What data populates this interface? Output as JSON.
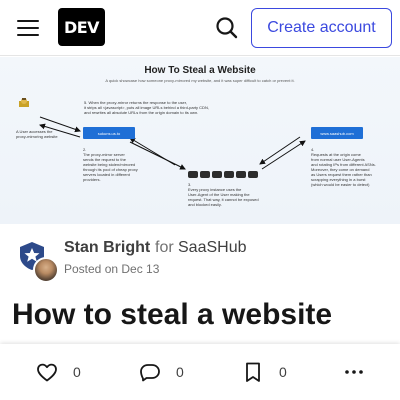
{
  "header": {
    "logo_text": "DEV",
    "create_account": "Create account"
  },
  "cover": {
    "title": "How To Steal a Website",
    "subtitle": "A quick showcase how someone proxy-mirrored my website, and it was super difficult to catch or prevent it.",
    "step1": [
      "A User accesses the",
      "proxy-mirroring website"
    ],
    "proxy_domain": "sukuns.us.to",
    "step2": [
      "2.",
      "The proxy-mirror server",
      "sends the request to the",
      "website being stolen/mirrored",
      "through its pool of cheap proxy",
      "servers located in different",
      "providers."
    ],
    "step3": [
      "3.",
      "Every proxy instance uses the",
      "User-Agent of the User making the",
      "request. That way, it cannot be exposed",
      "and blocked easily."
    ],
    "step4": [
      "4.",
      "Requests at the origin come",
      "from normal user User-Agents",
      "and rotating IPs from different ASNs.",
      "Moreover, they come on demand",
      "as Users request them rather than",
      "scrapping everything in a burst",
      "(which would be easier to detect)"
    ],
    "step5": [
      "5. When the proxy-mirror returns the response to the user,",
      "it strips all <javascript>, puts all image URLs behind a third-party CDN,",
      "and rewrites all absolute URLs from the origin domain to its own."
    ],
    "origin_domain": "www.saashub.com"
  },
  "author": {
    "name": "Stan Bright",
    "for_label": "for",
    "org": "SaaSHub",
    "posted": "Posted on Dec 13"
  },
  "post": {
    "title": "How to steal a website"
  },
  "actions": {
    "reactions": "0",
    "comments": "0",
    "saves": "0"
  },
  "colors": {
    "brand": "#3b49df",
    "box_blue": "#1f6fd6"
  }
}
